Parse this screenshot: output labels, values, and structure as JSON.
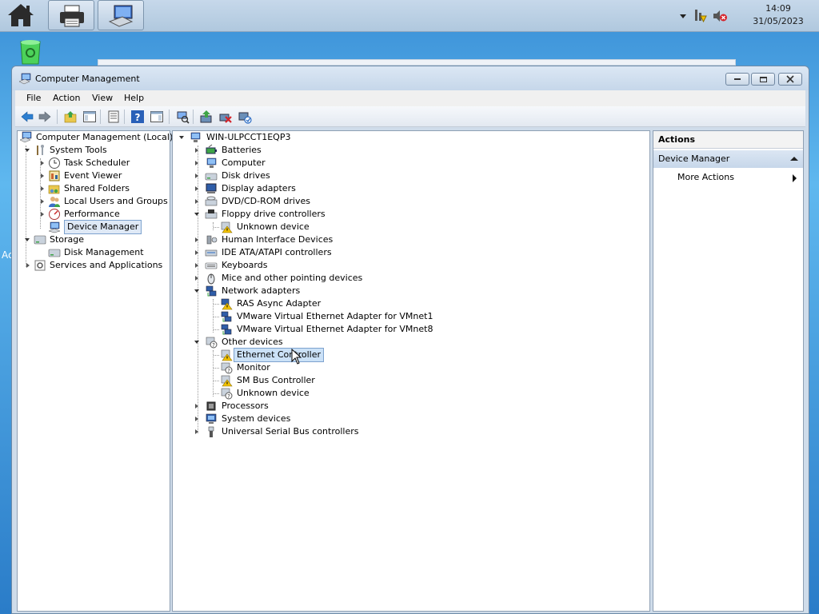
{
  "window": {
    "title": "Computer Management"
  },
  "menu": [
    "File",
    "Action",
    "View",
    "Help"
  ],
  "clock": {
    "time": "14:09",
    "date": "31/05/2023"
  },
  "left_tree": [
    {
      "label": "Computer Management (Local)",
      "icon": "computer-management-icon"
    },
    {
      "label": "System Tools",
      "icon": "system-tools-icon"
    },
    {
      "label": "Task Scheduler",
      "icon": "clock-icon"
    },
    {
      "label": "Event Viewer",
      "icon": "event-viewer-icon"
    },
    {
      "label": "Shared Folders",
      "icon": "shared-folder-icon"
    },
    {
      "label": "Local Users and Groups",
      "icon": "users-icon"
    },
    {
      "label": "Performance",
      "icon": "performance-icon"
    },
    {
      "label": "Device Manager",
      "icon": "device-manager-icon"
    },
    {
      "label": "Storage",
      "icon": "storage-icon"
    },
    {
      "label": "Disk Management",
      "icon": "disk-management-icon"
    },
    {
      "label": "Services and Applications",
      "icon": "services-icon"
    }
  ],
  "device_tree": [
    {
      "label": "WIN-ULPCCT1EQP3",
      "icon": "computer-icon"
    },
    {
      "label": "Batteries",
      "icon": "battery-icon"
    },
    {
      "label": "Computer",
      "icon": "computer-icon"
    },
    {
      "label": "Disk drives",
      "icon": "disk-drive-icon"
    },
    {
      "label": "Display adapters",
      "icon": "display-adapter-icon"
    },
    {
      "label": "DVD/CD-ROM drives",
      "icon": "dvd-icon"
    },
    {
      "label": "Floppy drive controllers",
      "icon": "floppy-controller-icon"
    },
    {
      "label": "Unknown device",
      "icon": "warning-device-icon"
    },
    {
      "label": "Human Interface Devices",
      "icon": "hid-icon"
    },
    {
      "label": "IDE ATA/ATAPI controllers",
      "icon": "ide-icon"
    },
    {
      "label": "Keyboards",
      "icon": "keyboard-icon"
    },
    {
      "label": "Mice and other pointing devices",
      "icon": "mouse-icon"
    },
    {
      "label": "Network adapters",
      "icon": "network-adapter-icon"
    },
    {
      "label": "RAS Async Adapter",
      "icon": "warning-network-icon"
    },
    {
      "label": "VMware Virtual Ethernet Adapter for VMnet1",
      "icon": "network-adapter-icon"
    },
    {
      "label": "VMware Virtual Ethernet Adapter for VMnet8",
      "icon": "network-adapter-icon"
    },
    {
      "label": "Other devices",
      "icon": "other-devices-icon"
    },
    {
      "label": "Ethernet Controller",
      "icon": "warning-device-icon"
    },
    {
      "label": "Monitor",
      "icon": "unknown-device-icon"
    },
    {
      "label": "SM Bus Controller",
      "icon": "warning-device-icon"
    },
    {
      "label": "Unknown device",
      "icon": "unknown-device-icon"
    },
    {
      "label": "Processors",
      "icon": "processor-icon"
    },
    {
      "label": "System devices",
      "icon": "system-devices-icon"
    },
    {
      "label": "Universal Serial Bus controllers",
      "icon": "usb-icon"
    }
  ],
  "actions": {
    "header": "Actions",
    "group": "Device Manager",
    "more": "More Actions"
  },
  "colors": {
    "selection": "#cbe1f7",
    "selection_border": "#7da2ce",
    "actions_group": "#c7d7ea"
  }
}
